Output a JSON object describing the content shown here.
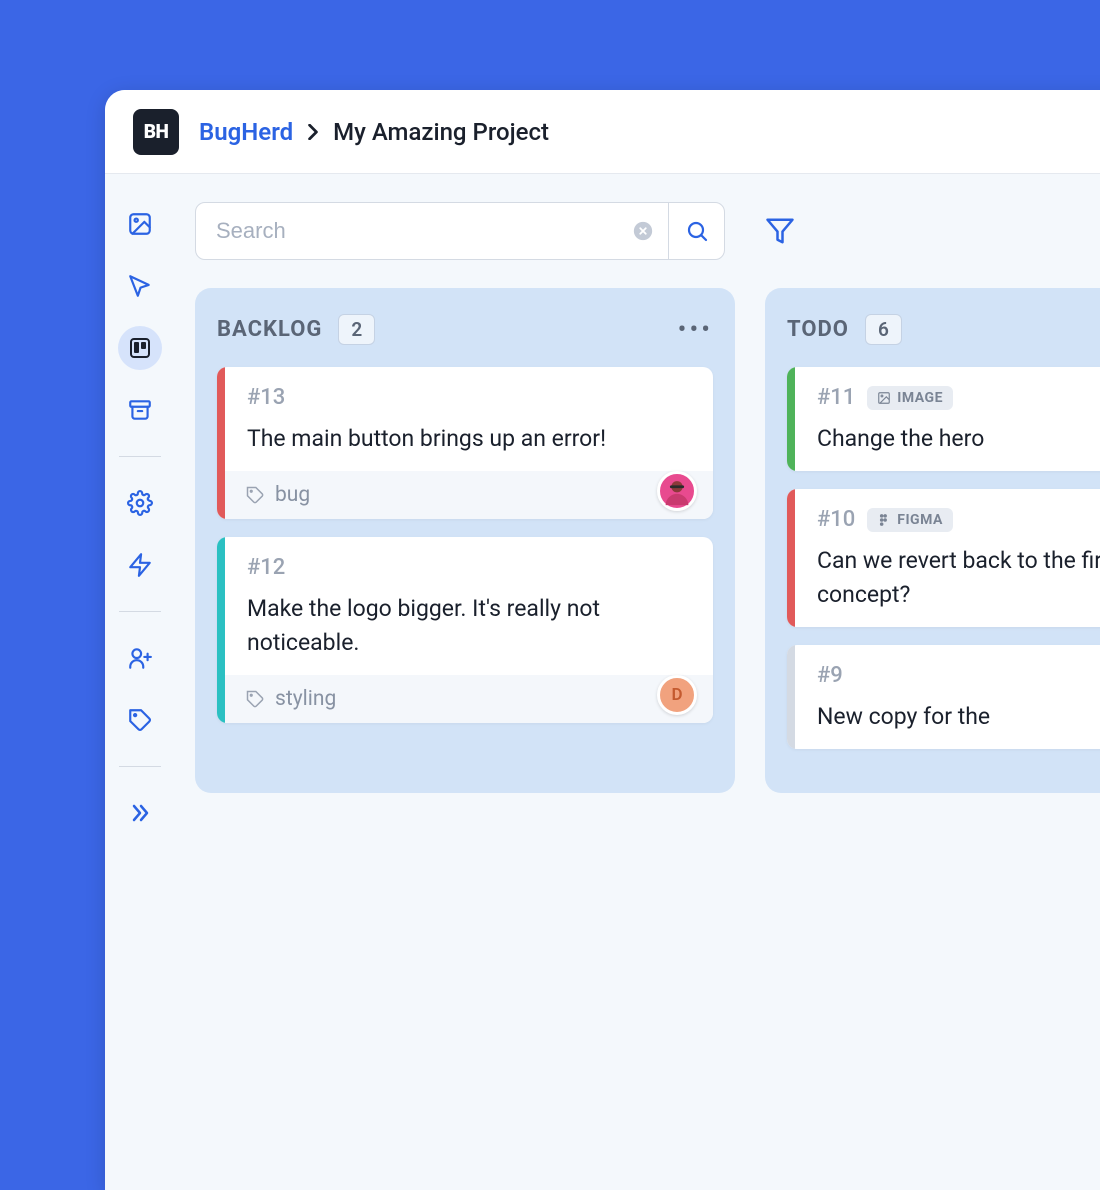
{
  "header": {
    "logo_text": "BH",
    "brand": "BugHerd",
    "project": "My Amazing Project"
  },
  "search": {
    "placeholder": "Search"
  },
  "columns": [
    {
      "title": "BACKLOG",
      "count": "2",
      "cards": [
        {
          "id": "#13",
          "text": "The main button brings up an error!",
          "tag": "bug",
          "accent": "#e15a5a",
          "avatar_bg": "#e84a8f",
          "avatar_letter": ""
        },
        {
          "id": "#12",
          "text": "Make the logo bigger. It's really not noticeable.",
          "tag": "styling",
          "accent": "#2bc0c2",
          "avatar_bg": "#f1a27e",
          "avatar_letter": "D"
        }
      ]
    },
    {
      "title": "TODO",
      "count": "6",
      "cards": [
        {
          "id": "#11",
          "text": "Change the hero",
          "source": "IMAGE",
          "accent": "#4fb35a"
        },
        {
          "id": "#10",
          "text": "Can we revert back to the first concept?",
          "source": "FIGMA",
          "accent": "#e15a5a"
        },
        {
          "id": "#9",
          "text": "New copy for the",
          "accent": "#d4dae3"
        }
      ]
    }
  ]
}
